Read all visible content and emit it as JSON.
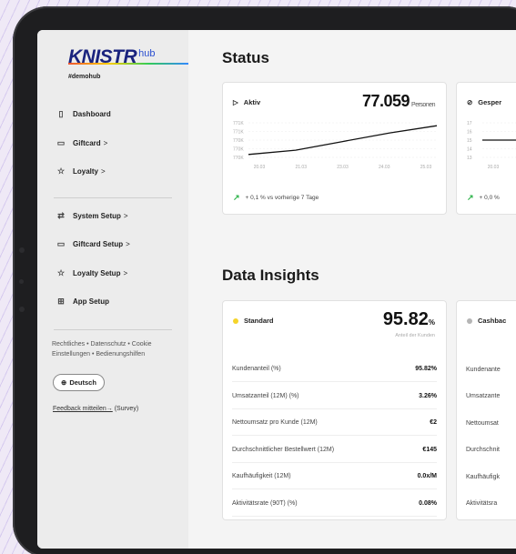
{
  "sidebar": {
    "logo": {
      "brand": "KNISTR",
      "hub": "hub",
      "tag": "#demohub"
    },
    "nav_primary": [
      {
        "label": "Dashboard",
        "icon": "document-icon",
        "chev": ""
      },
      {
        "label": "Giftcard",
        "icon": "card-icon",
        "chev": ">"
      },
      {
        "label": "Loyalty",
        "icon": "star-icon",
        "chev": ">"
      }
    ],
    "nav_setup": [
      {
        "label": "System Setup",
        "icon": "transfer-icon",
        "chev": ">"
      },
      {
        "label": "Giftcard Setup",
        "icon": "card-icon",
        "chev": ">"
      },
      {
        "label": "Loyalty Setup",
        "icon": "star-list-icon",
        "chev": ">"
      },
      {
        "label": "App Setup",
        "icon": "grid-icon",
        "chev": ""
      }
    ],
    "legal": "Rechtliches • Datenschutz • Cookie Einstellungen • Bedienungshilfen",
    "language": "Deutsch",
    "feedback_link": "Feedback mitteilen→",
    "feedback_suffix": " (Survey)"
  },
  "status": {
    "title": "Status",
    "card1": {
      "label": "Aktiv",
      "value": "77.059",
      "unit": "Personen",
      "trend": "+ 0,1 % vs vorherige 7 Tage",
      "ylabels": [
        "771K",
        "771K",
        "770K",
        "770K",
        "770K"
      ],
      "xlabels": [
        "20.03",
        "21.03",
        "23.03",
        "24.03",
        "25.03"
      ],
      "series": [
        770.0,
        770.3,
        770.9,
        771.5,
        772.0
      ]
    },
    "card2": {
      "label": "Gesper",
      "trend": "+ 0,0 %",
      "ylabels": [
        "17",
        "16",
        "15",
        "14",
        "13"
      ],
      "xlabels": [
        "20.03"
      ]
    }
  },
  "insights": {
    "title": "Data Insights",
    "card1": {
      "label": "Standard",
      "dot_color": "#f5d42a",
      "percent": "95.82",
      "percent_sign": "%",
      "sub": "Anteil der Kunden",
      "rows": [
        {
          "label": "Kundenanteil (%)",
          "value": "95.82%"
        },
        {
          "label": "Umsatzanteil (12M) (%)",
          "value": "3.26%"
        },
        {
          "label": "Nettoumsatz pro Kunde (12M)",
          "value": "€2"
        },
        {
          "label": "Durchschnittlicher Bestellwert (12M)",
          "value": "€145"
        },
        {
          "label": "Kaufhäufigkeit (12M)",
          "value": "0.0x/M"
        },
        {
          "label": "Aktivitätsrate (90T) (%)",
          "value": "0.08%"
        }
      ]
    },
    "card2": {
      "label": "Cashbac",
      "dot_color": "#b5b5b5",
      "rows": [
        "Kundenante",
        "Umsatzante",
        "Nettoumsat",
        "Durchschnit",
        "Kaufhäufigk",
        "Aktivitätsra"
      ]
    }
  }
}
